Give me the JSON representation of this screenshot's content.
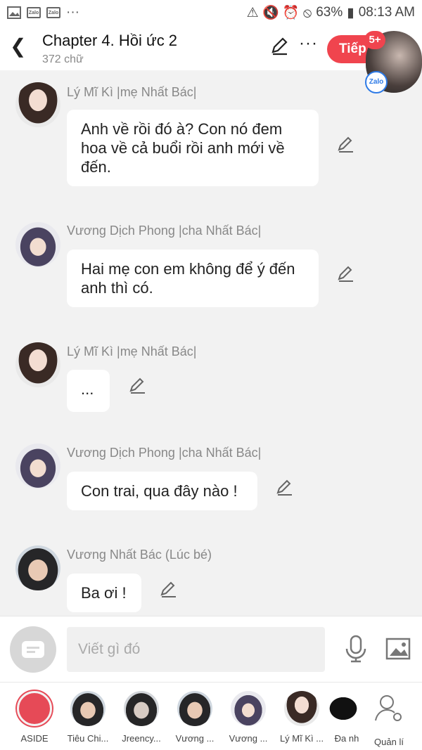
{
  "status_bar": {
    "battery": "63%",
    "time": "08:13 AM",
    "left_icons": [
      "image-icon",
      "zalo-icon",
      "zalo-icon",
      "more-icon"
    ]
  },
  "header": {
    "title": "Chapter 4. Hồi ức 2",
    "subtitle": "372 chữ",
    "next_label": "Tiếp",
    "badge": "5+",
    "bubble_app": "Zalo"
  },
  "messages": [
    {
      "sender": "Lý Mĩ Kì |mẹ Nhất Bác|",
      "text": "Anh về rồi đó à? Con nó đem hoa về cả buổi rồi anh mới về đến."
    },
    {
      "sender": "Vương Dịch Phong |cha Nhất Bác|",
      "text": "Hai mẹ con em không để ý đến anh thì có."
    },
    {
      "sender": "Lý Mĩ Kì |mẹ Nhất Bác|",
      "text": "..."
    },
    {
      "sender": "Vương Dịch Phong |cha Nhất Bác|",
      "text": "Con trai, qua đây nào !"
    },
    {
      "sender": "Vương Nhất Bác (Lúc bé)",
      "text": "Ba ơi !"
    }
  ],
  "input": {
    "placeholder": "Viết gì đó"
  },
  "characters": [
    {
      "name": "ASIDE"
    },
    {
      "name": "Tiêu Chi..."
    },
    {
      "name": "Jreency..."
    },
    {
      "name": "Vương ..."
    },
    {
      "name": "Vương ..."
    },
    {
      "name": "Lý Mĩ Kì ..."
    },
    {
      "name": "Đa nh"
    },
    {
      "name": "Quản lí"
    }
  ]
}
